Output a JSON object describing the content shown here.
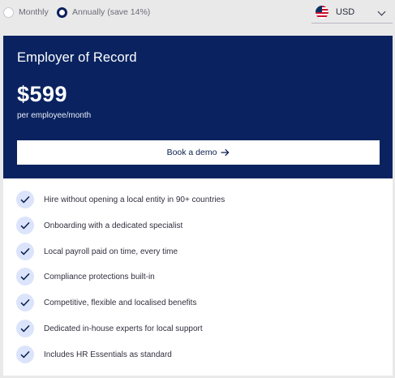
{
  "billing": {
    "monthly_label": "Monthly",
    "annually_label": "Annually (save 14%)",
    "selected": "annually"
  },
  "currency": {
    "code": "USD",
    "flag_icon": "us-flag-icon"
  },
  "plan": {
    "title": "Employer of Record",
    "price": "$599",
    "price_unit": "per employee/month",
    "cta_label": "Book a demo",
    "header_color": "#0a2360"
  },
  "features": [
    "Hire without opening a local entity in 90+ countries",
    "Onboarding with a dedicated specialist",
    "Local payroll paid on time, every time",
    "Compliance protections built-in",
    "Competitive, flexible and localised benefits",
    "Dedicated in-house experts for local support",
    "Includes HR Essentials as standard"
  ]
}
